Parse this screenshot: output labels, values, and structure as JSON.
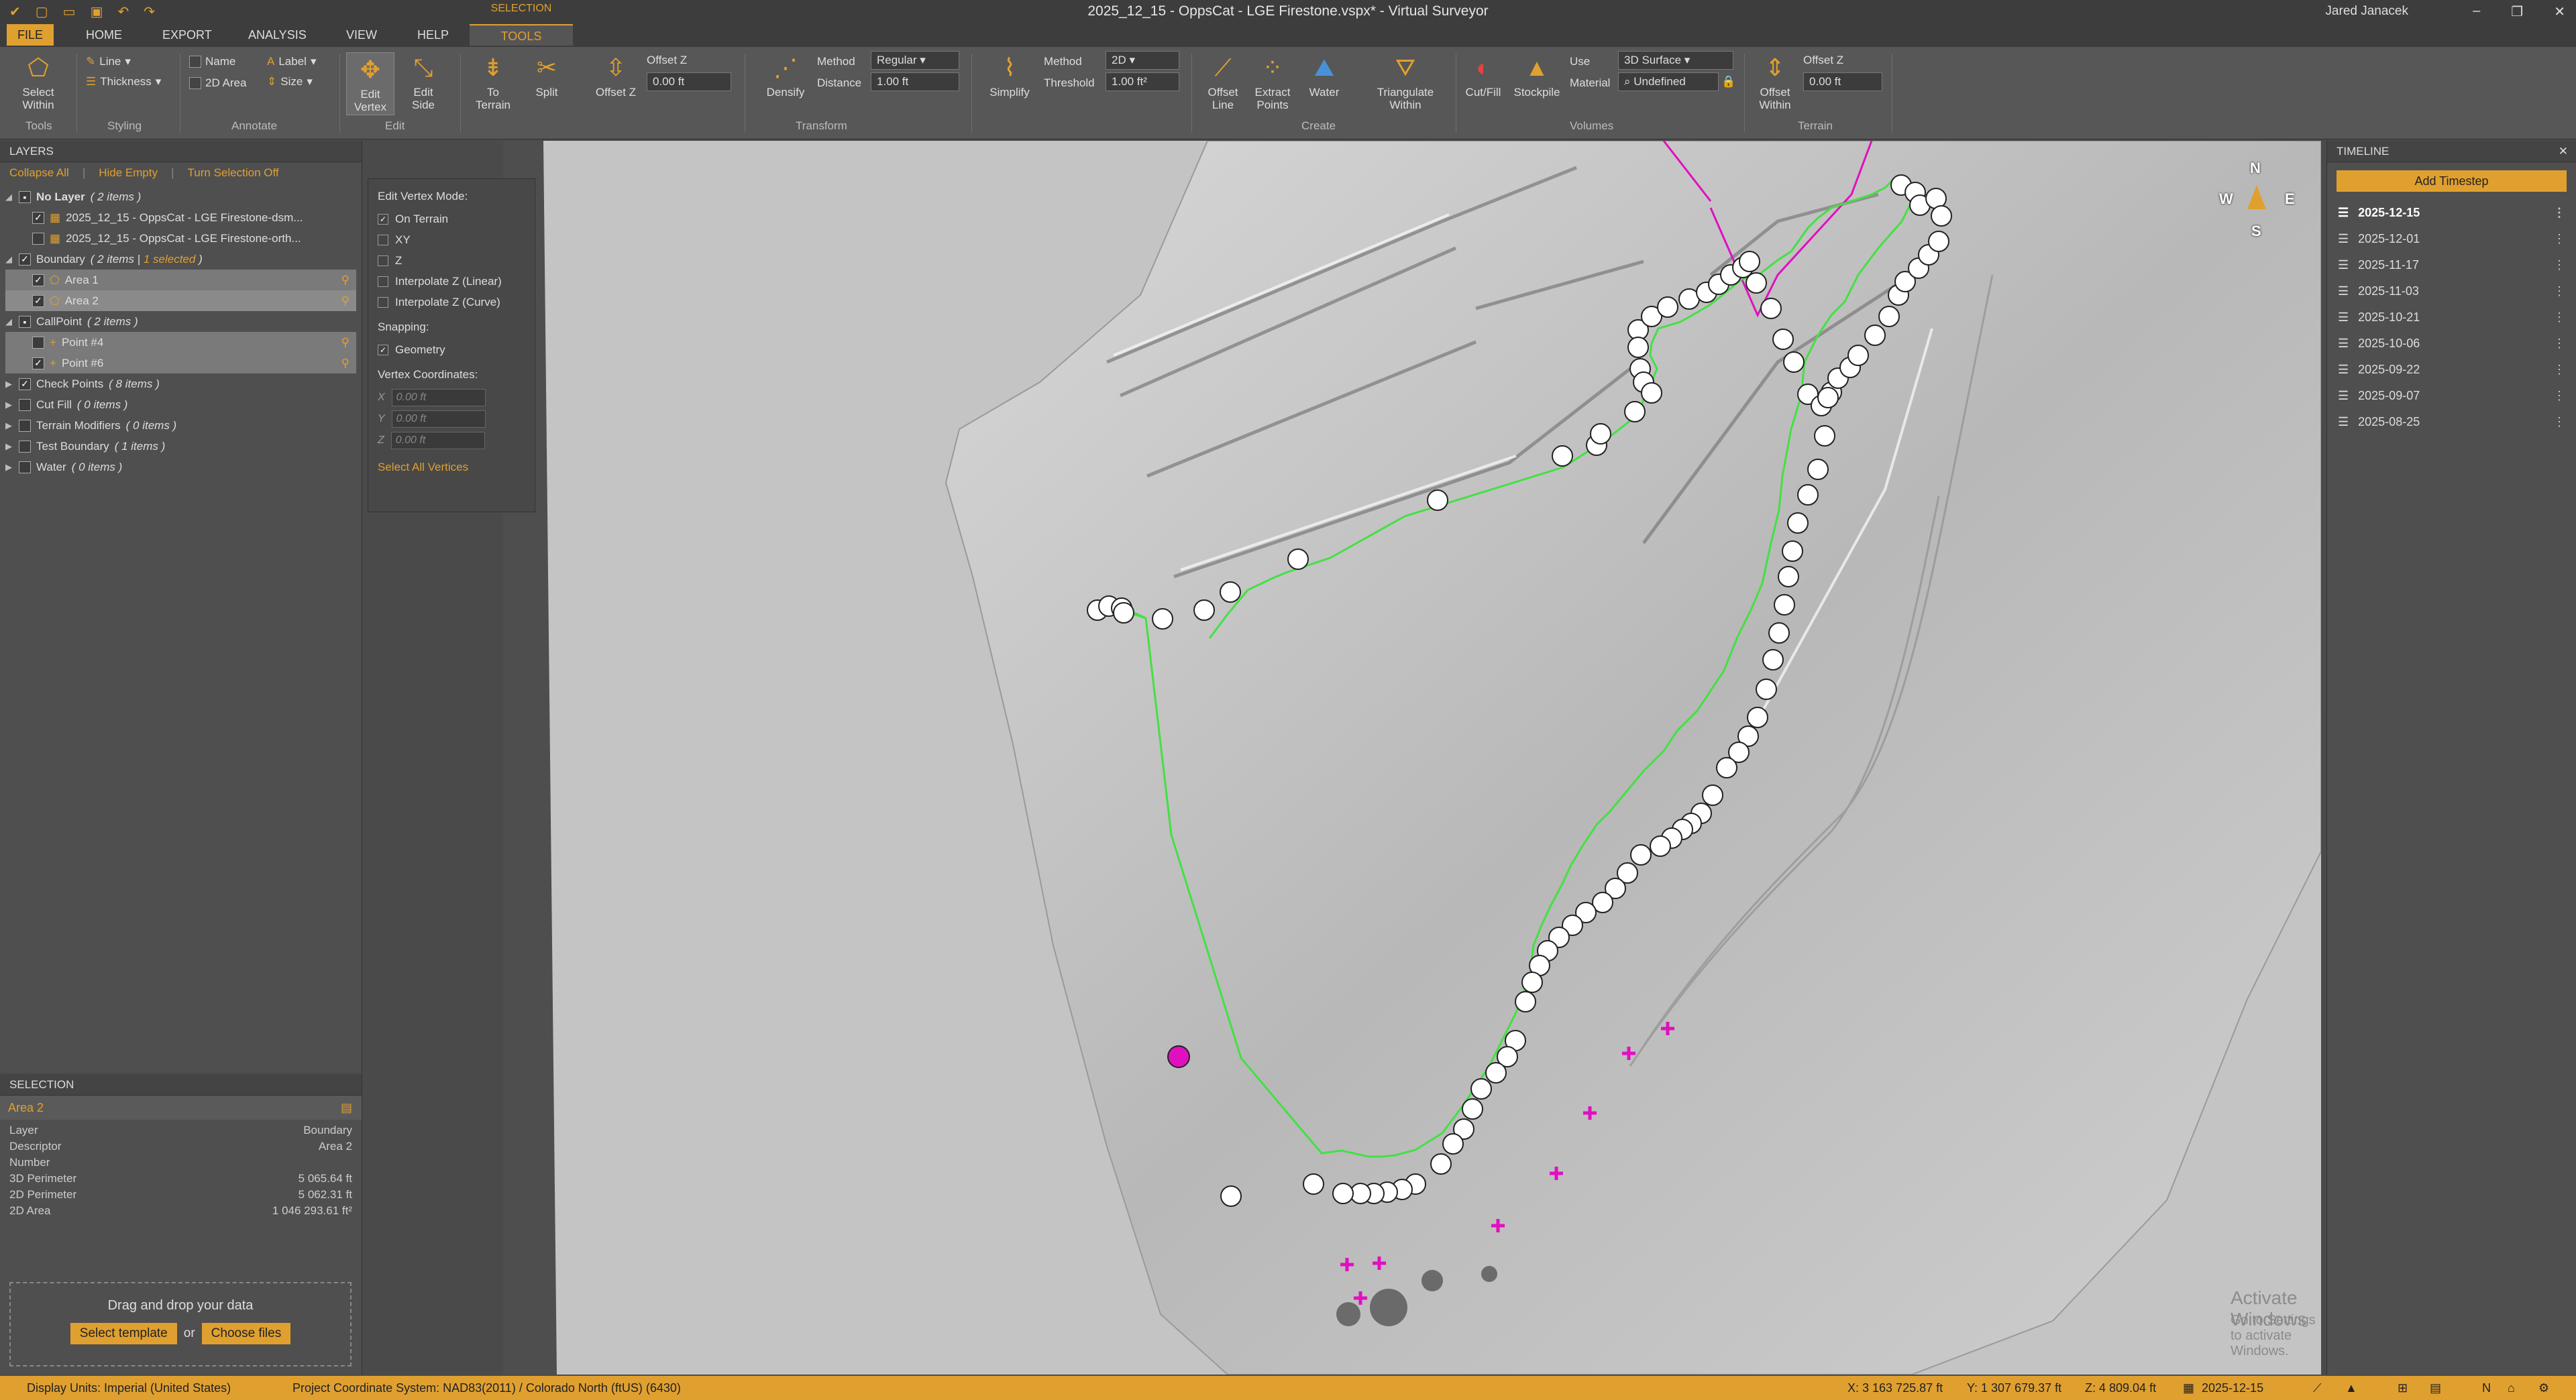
{
  "window": {
    "title": "2025_12_15 - OppsCat - LGE Firestone.vspx* - Virtual Surveyor",
    "user": "Jared Janacek",
    "context_tab": "SELECTION"
  },
  "tabs": [
    "FILE",
    "HOME",
    "EXPORT",
    "ANALYSIS",
    "VIEW",
    "HELP",
    "TOOLS"
  ],
  "ribbon": {
    "select_within": "Select Within",
    "tools_group": "Tools",
    "line": "Line",
    "thickness": "Thickness",
    "styling_group": "Styling",
    "name": "Name",
    "area_2d": "2D Area",
    "label": "Label",
    "size": "Size",
    "annotate_group": "Annotate",
    "edit_vertex": "Edit Vertex",
    "edit_side": "Edit Side",
    "edit_group": "Edit",
    "to_terrain": "To Terrain",
    "split": "Split",
    "offset_z": "Offset Z",
    "offset_z_label": "Offset Z",
    "offset_z_value": "0.00 ft",
    "densify": "Densify",
    "method_label": "Method",
    "method_value": "Regular",
    "distance_label": "Distance",
    "distance_value": "1.00 ft",
    "transform_group": "Transform",
    "simplify": "Simplify",
    "method2_label": "Method",
    "method2_value": "2D",
    "threshold_label": "Threshold",
    "threshold_value": "1.00 ft²",
    "offset_line": "Offset Line",
    "extract_points": "Extract Points",
    "water": "Water",
    "triangulate_within": "Triangulate Within",
    "create_group": "Create",
    "cut_fill": "Cut/Fill",
    "stockpile": "Stockpile",
    "use_label": "Use",
    "use_value": "3D Surface",
    "material_label": "Material",
    "material_value": "Undefined",
    "volumes_group": "Volumes",
    "offset_within": "Offset Within",
    "offset_z2_label": "Offset Z",
    "offset_z2_value": "0.00 ft",
    "terrain_group": "Terrain"
  },
  "layers": {
    "header": "LAYERS",
    "collapse_all": "Collapse All",
    "hide_empty": "Hide Empty",
    "turn_selection_off": "Turn Selection Off",
    "no_layer": "No Layer",
    "no_layer_count": "( 2 items )",
    "no_layer_items": [
      "2025_12_15 - OppsCat - LGE Firestone-dsm...",
      "2025_12_15 - OppsCat - LGE Firestone-orth..."
    ],
    "boundary": "Boundary",
    "boundary_count": "( 2 items |",
    "boundary_selected": "1 selected",
    "boundary_close": ")",
    "boundary_items": [
      "Area 1",
      "Area 2"
    ],
    "callpoint": "CallPoint",
    "callpoint_count": "( 2 items )",
    "callpoint_items": [
      "Point #4",
      "Point #6"
    ],
    "others": [
      {
        "name": "Check Points",
        "count": "( 8 items )",
        "checked": true
      },
      {
        "name": "Cut Fill",
        "count": "( 0 items )",
        "checked": false
      },
      {
        "name": "Terrain Modifiers",
        "count": "( 0 items )",
        "checked": false
      },
      {
        "name": "Test Boundary",
        "count": "( 1 items )",
        "checked": false
      },
      {
        "name": "Water",
        "count": "( 0 items )",
        "checked": false
      }
    ]
  },
  "selection": {
    "header": "SELECTION",
    "title": "Area 2",
    "props": [
      {
        "k": "Layer",
        "v": "Boundary"
      },
      {
        "k": "Descriptor",
        "v": "Area 2"
      },
      {
        "k": "Number",
        "v": ""
      },
      {
        "k": "3D Perimeter",
        "v": "5 065.64 ft"
      },
      {
        "k": "2D Perimeter",
        "v": "5 062.31 ft"
      },
      {
        "k": "2D Area",
        "v": "1 046 293.61 ft²"
      }
    ],
    "drop_text": "Drag and drop your data",
    "select_template": "Select template",
    "or": "or",
    "choose_files": "Choose files"
  },
  "vertex_panel": {
    "mode_title": "Edit Vertex Mode:",
    "modes": [
      {
        "label": "On Terrain",
        "checked": true
      },
      {
        "label": "XY",
        "checked": false
      },
      {
        "label": "Z",
        "checked": false
      },
      {
        "label": "Interpolate Z (Linear)",
        "checked": false
      },
      {
        "label": "Interpolate Z (Curve)",
        "checked": false
      }
    ],
    "snapping_title": "Snapping:",
    "geometry": "Geometry",
    "coords_title": "Vertex Coordinates:",
    "x_label": "X",
    "x_value": "0.00 ft",
    "y_label": "Y",
    "y_value": "0.00 ft",
    "z_label": "Z",
    "z_value": "0.00 ft",
    "select_all": "Select All Vertices"
  },
  "compass": {
    "n": "N",
    "s": "S",
    "e": "E",
    "w": "W"
  },
  "timeline": {
    "header": "TIMELINE",
    "add": "Add Timestep",
    "dates": [
      "2025-12-15",
      "2025-12-01",
      "2025-11-17",
      "2025-11-03",
      "2025-10-21",
      "2025-10-06",
      "2025-09-22",
      "2025-09-07",
      "2025-08-25"
    ]
  },
  "watermark": {
    "line1": "Activate Windows",
    "line2": "Go to Settings to activate Windows."
  },
  "status": {
    "display_units": "Display Units:  Imperial (United States)",
    "crs": "Project Coordinate System:  NAD83(2011) / Colorado North (ftUS) (6430)",
    "x": "X: 3 163 725.87 ft",
    "y": "Y: 1 307 679.37 ft",
    "z": "Z: 4 809.04 ft",
    "date": "2025-12-15"
  },
  "colors": {
    "accent": "#e0a030",
    "boundary_line": "#44e044",
    "selected_vertex": "#e010c0",
    "callpoint": "#e010c0"
  }
}
